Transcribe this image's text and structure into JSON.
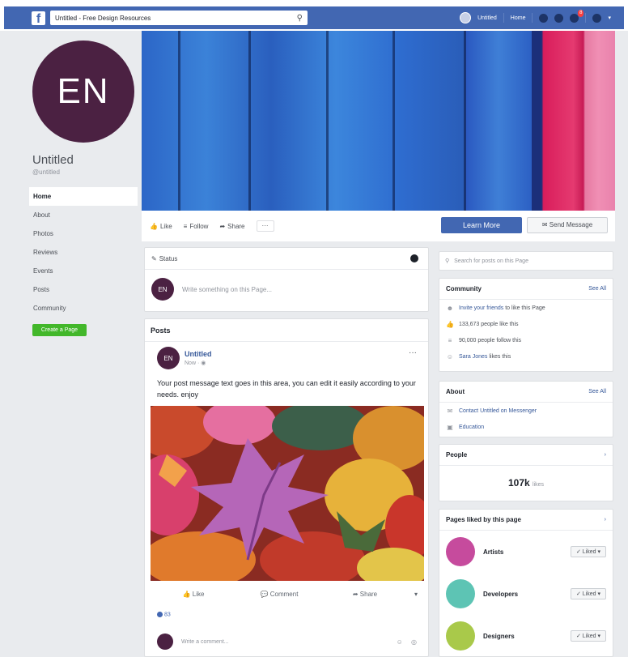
{
  "topbar": {
    "logo": "f",
    "search_value": "Untitled - Free Design Resources",
    "search_icon": "search-icon",
    "username": "Untitled",
    "home_label": "Home",
    "notification_count": "8"
  },
  "profile": {
    "initials": "EN",
    "name": "Untitled",
    "handle": "@untitled"
  },
  "nav": {
    "items": [
      "Home",
      "About",
      "Photos",
      "Reviews",
      "Events",
      "Posts",
      "Community"
    ],
    "create_page": "Create a Page"
  },
  "colors": {
    "brand_blue": "#4267b2",
    "profile_purple": "#4b2142",
    "green": "#42b72a"
  },
  "actionbar": {
    "like": "Like",
    "follow": "Follow",
    "share": "Share",
    "more": "···",
    "learn_more": "Learn More",
    "send_message": "Send Message"
  },
  "composer": {
    "tab": "Status",
    "avatar": "EN",
    "placeholder": "Write something on this Page..."
  },
  "posts": {
    "heading": "Posts",
    "author": "Untitled",
    "time": "Now",
    "avatar": "EN",
    "menu": "···",
    "text": "Your post message text goes in this area, you can edit it easily according to your needs. enjoy",
    "actions": [
      "Like",
      "Comment",
      "Share"
    ],
    "reactions": "83",
    "comment_placeholder": "Write a comment...",
    "comment_icons": "☺ ◎"
  },
  "sidebar": {
    "search_placeholder": "Search for posts on this Page",
    "community": {
      "title": "Community",
      "see_all": "See All",
      "invite_link": "Invite your friends",
      "invite_rest": "to like this Page",
      "likes": "133,673 people like this",
      "follows": "90,000 people follow this",
      "friends_link": "Sara Jones",
      "friends_rest": "likes this"
    },
    "about": {
      "title": "About",
      "see_all": "See All",
      "contact": "Contact Untitled on Messenger",
      "category": "Education"
    },
    "people": {
      "title": "People",
      "count": "107k",
      "count_suffix": "likes"
    },
    "liked_pages": {
      "title": "Pages liked by this page",
      "items": [
        {
          "name": "Artists",
          "button": "✓ Liked ▾",
          "color": "#c64b9d"
        },
        {
          "name": "Developers",
          "button": "✓ Liked ▾",
          "color": "#5dc4b4"
        },
        {
          "name": "Designers",
          "button": "✓ Liked ▾",
          "color": "#a9c94a"
        }
      ]
    }
  }
}
